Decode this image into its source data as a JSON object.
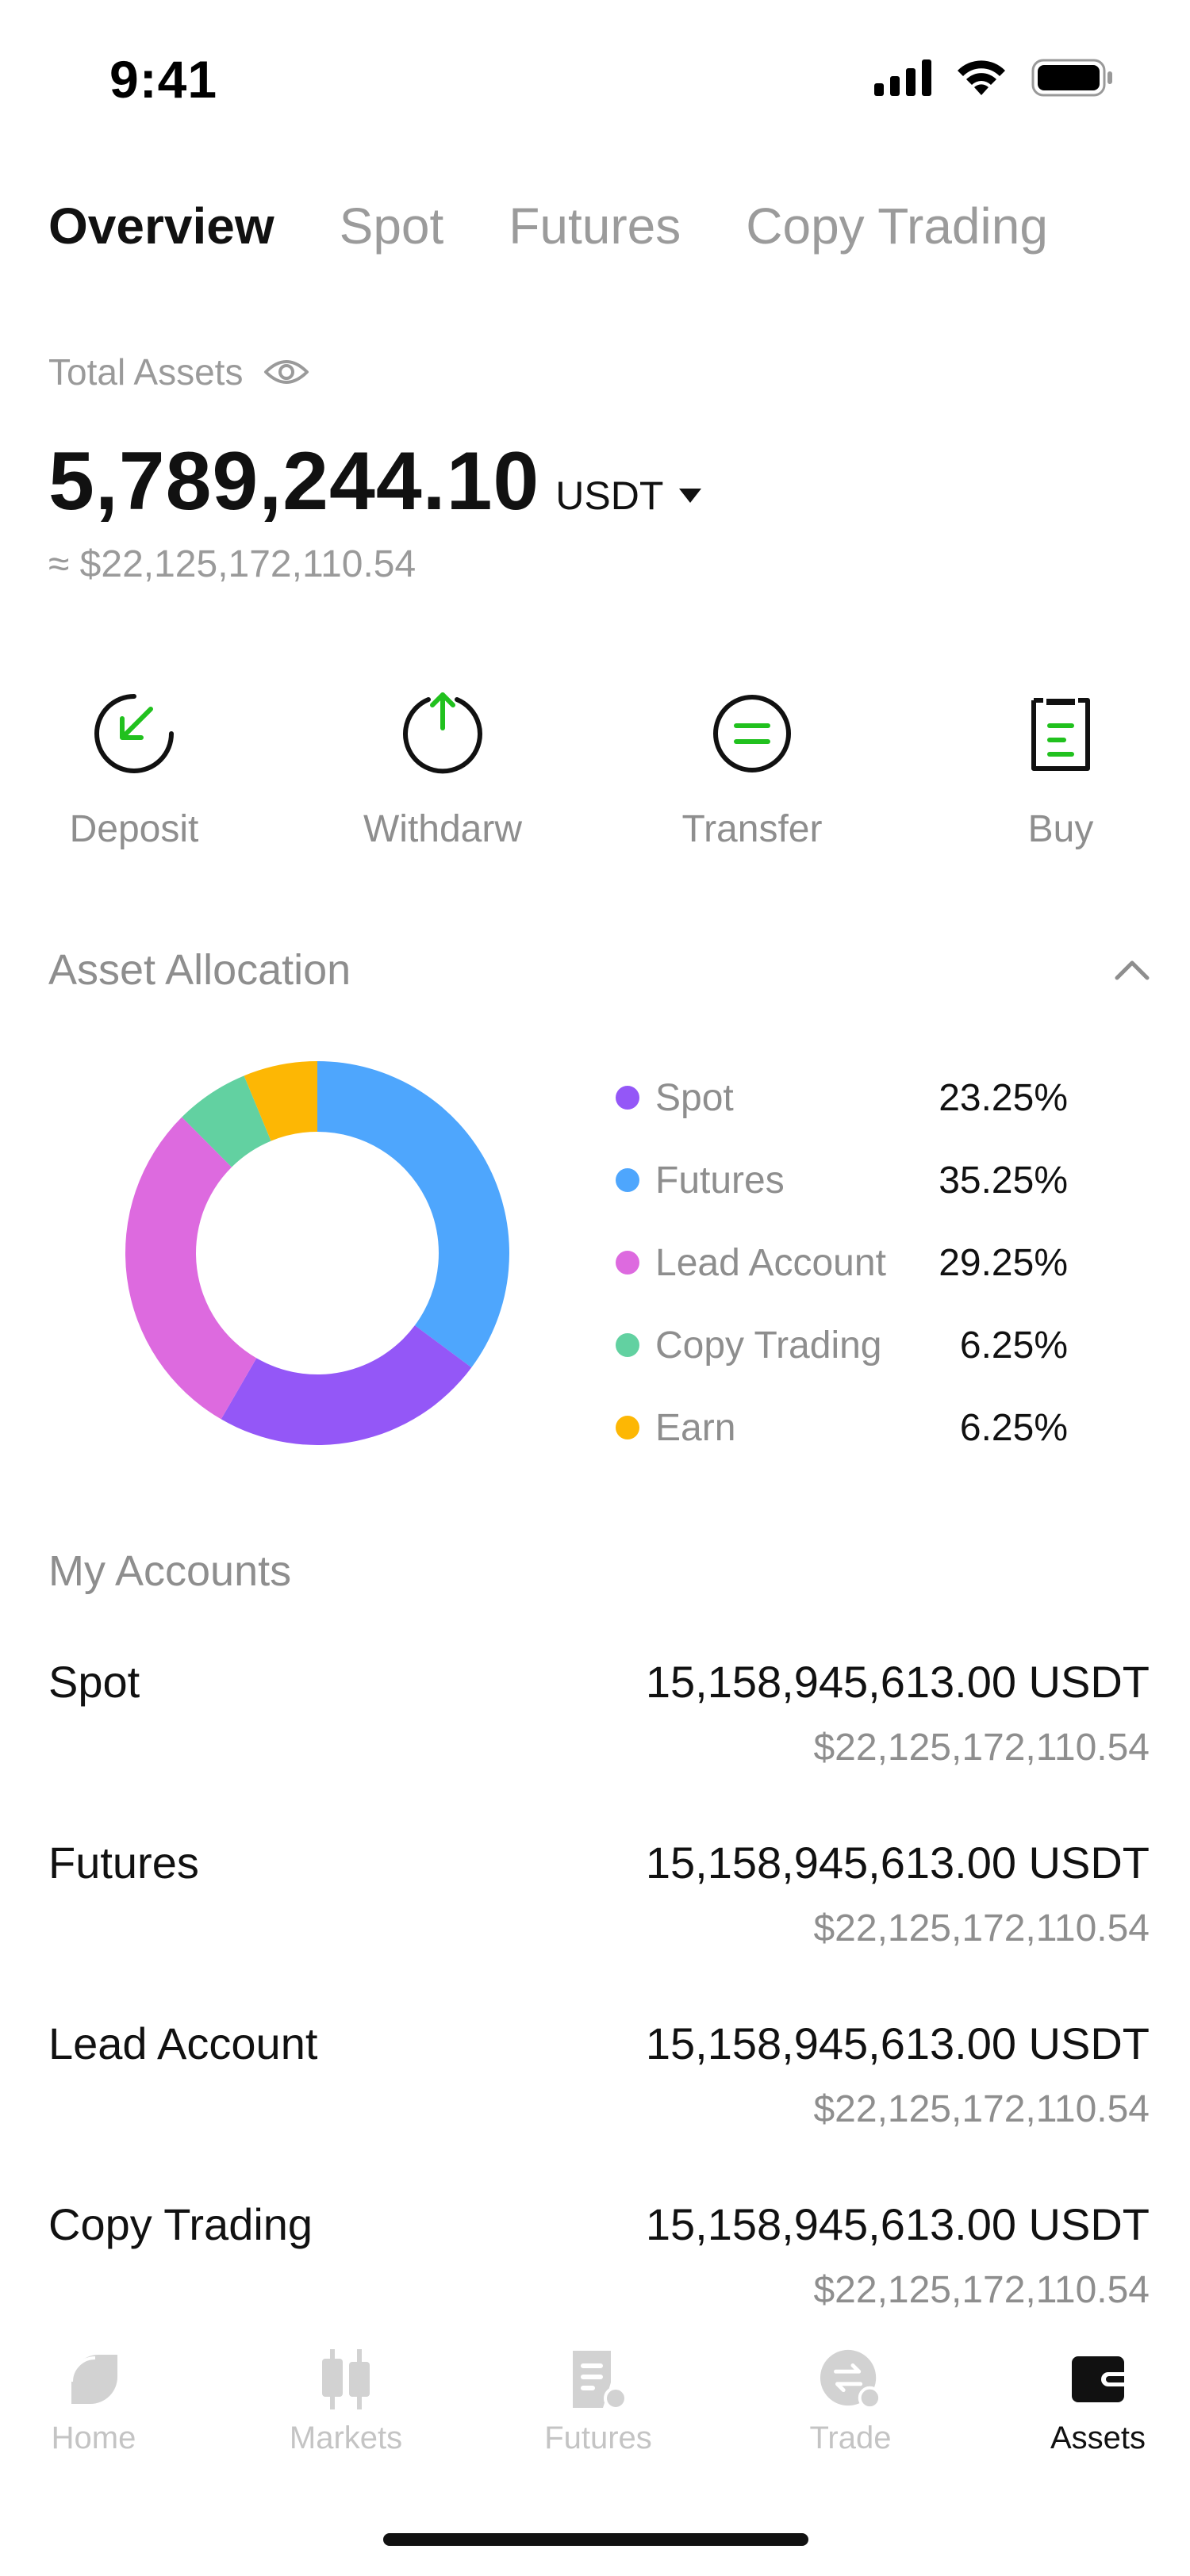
{
  "status_bar": {
    "time": "9:41"
  },
  "tabs": [
    {
      "label": "Overview",
      "active": true
    },
    {
      "label": "Spot",
      "active": false
    },
    {
      "label": "Futures",
      "active": false
    },
    {
      "label": "Copy Trading",
      "active": false
    }
  ],
  "total_assets": {
    "label": "Total Assets",
    "value": "5,789,244.10",
    "unit": "USDT",
    "fiat": "≈ $22,125,172,110.54"
  },
  "actions": [
    {
      "label": "Deposit",
      "icon": "deposit-icon"
    },
    {
      "label": "Withdarw",
      "icon": "withdraw-icon"
    },
    {
      "label": "Transfer",
      "icon": "transfer-icon"
    },
    {
      "label": "Buy",
      "icon": "buy-icon"
    }
  ],
  "allocation": {
    "title": "Asset Allocation",
    "items": [
      {
        "name": "Spot",
        "pct": "23.25%",
        "value": 23.25,
        "color": "#9457F7"
      },
      {
        "name": "Futures",
        "pct": "35.25%",
        "value": 35.25,
        "color": "#4EA6FD"
      },
      {
        "name": "Lead Account",
        "pct": "29.25%",
        "value": 29.25,
        "color": "#DD6ADF"
      },
      {
        "name": "Copy Trading",
        "pct": "6.25%",
        "value": 6.25,
        "color": "#62D1A1"
      },
      {
        "name": "Earn",
        "pct": "6.25%",
        "value": 6.25,
        "color": "#FDB704"
      }
    ]
  },
  "chart_data": {
    "type": "pie",
    "categories": [
      "Futures",
      "Spot",
      "Lead Account",
      "Copy Trading",
      "Earn"
    ],
    "values": [
      35.25,
      23.25,
      29.25,
      6.25,
      6.25
    ],
    "colors": [
      "#4EA6FD",
      "#9457F7",
      "#DD6ADF",
      "#62D1A1",
      "#FDB704"
    ],
    "donut": true,
    "title": ""
  },
  "accounts": {
    "title": "My Accounts",
    "items": [
      {
        "name": "Spot",
        "amount": "15,158,945,613.00 USDT",
        "fiat": "$22,125,172,110.54"
      },
      {
        "name": "Futures",
        "amount": "15,158,945,613.00 USDT",
        "fiat": "$22,125,172,110.54"
      },
      {
        "name": "Lead Account",
        "amount": "15,158,945,613.00 USDT",
        "fiat": "$22,125,172,110.54"
      },
      {
        "name": "Copy Trading",
        "amount": "15,158,945,613.00 USDT",
        "fiat": "$22,125,172,110.54"
      }
    ]
  },
  "bottom_nav": [
    {
      "label": "Home",
      "icon": "home-icon",
      "active": false
    },
    {
      "label": "Markets",
      "icon": "markets-icon",
      "active": false
    },
    {
      "label": "Futures",
      "icon": "futures-icon",
      "active": false
    },
    {
      "label": "Trade",
      "icon": "trade-icon",
      "active": false
    },
    {
      "label": "Assets",
      "icon": "wallet-icon",
      "active": true
    }
  ]
}
